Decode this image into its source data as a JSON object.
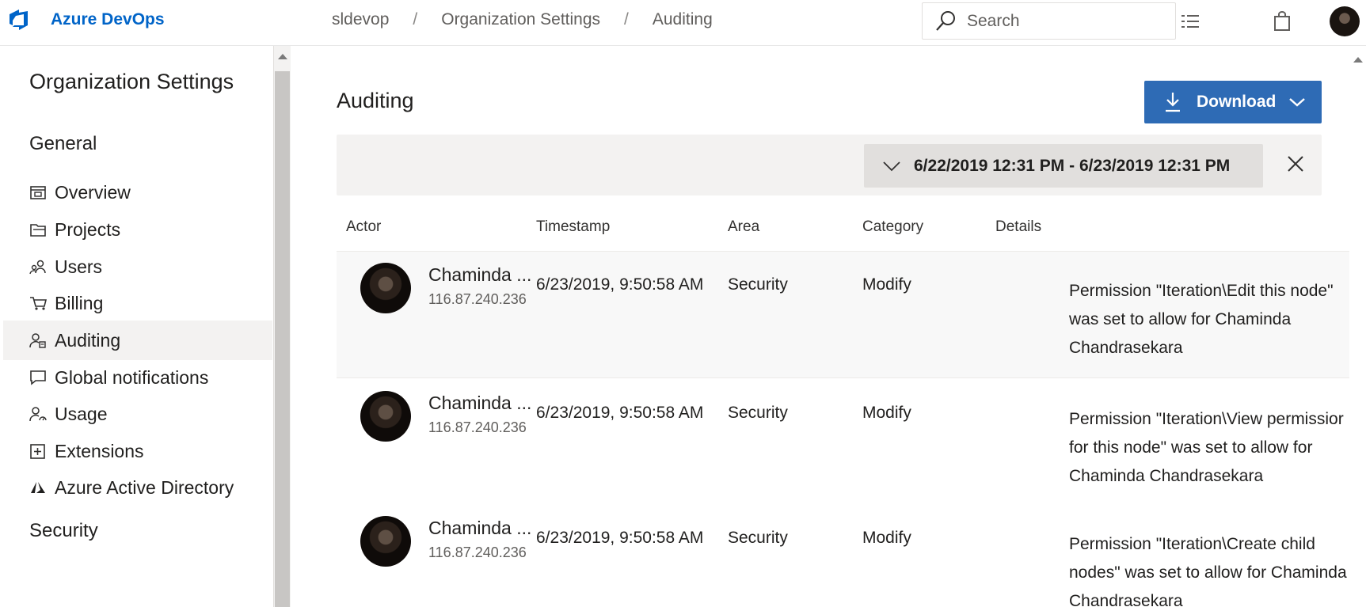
{
  "header": {
    "app_name": "Azure DevOps",
    "breadcrumbs": [
      "sldevop",
      "Organization Settings",
      "Auditing"
    ],
    "search_placeholder": "Search"
  },
  "sidebar": {
    "title": "Organization Settings",
    "sections": [
      {
        "label": "General"
      },
      {
        "label": "Security"
      }
    ],
    "items": [
      {
        "label": "Overview",
        "icon": "overview-icon"
      },
      {
        "label": "Projects",
        "icon": "projects-icon"
      },
      {
        "label": "Users",
        "icon": "users-icon"
      },
      {
        "label": "Billing",
        "icon": "cart-icon"
      },
      {
        "label": "Auditing",
        "icon": "auditing-icon",
        "selected": true
      },
      {
        "label": "Global notifications",
        "icon": "chat-icon"
      },
      {
        "label": "Usage",
        "icon": "usage-icon"
      },
      {
        "label": "Extensions",
        "icon": "extensions-icon"
      },
      {
        "label": "Azure Active Directory",
        "icon": "azure-ad-icon"
      }
    ]
  },
  "main": {
    "title": "Auditing",
    "download_label": "Download",
    "date_range": "6/22/2019 12:31 PM - 6/23/2019 12:31 PM",
    "columns": [
      "Actor",
      "Timestamp",
      "Area",
      "Category",
      "Details"
    ],
    "rows": [
      {
        "actor": "Chaminda ...",
        "ip": "116.87.240.236",
        "timestamp": "6/23/2019, 9:50:58 AM",
        "area": "Security",
        "category": "Modify",
        "details": [
          "Permission \"Iteration\\Edit this node\"",
          "was set to allow for Chaminda",
          "Chandrasekara"
        ]
      },
      {
        "actor": "Chaminda ...",
        "ip": "116.87.240.236",
        "timestamp": "6/23/2019, 9:50:58 AM",
        "area": "Security",
        "category": "Modify",
        "details": [
          "Permission \"Iteration\\View permissior",
          "for this node\" was set to allow for",
          "Chaminda Chandrasekara"
        ]
      },
      {
        "actor": "Chaminda ...",
        "ip": "116.87.240.236",
        "timestamp": "6/23/2019, 9:50:58 AM",
        "area": "Security",
        "category": "Modify",
        "details": [
          "Permission \"Iteration\\Create child",
          "nodes\" was set to allow for Chaminda",
          "Chandrasekara"
        ]
      }
    ]
  },
  "colors": {
    "brand": "#0064c8",
    "primary_button": "#2e6bb5",
    "selected_nav": "#f3f2f1",
    "filter_bar": "#f3f2f1"
  }
}
